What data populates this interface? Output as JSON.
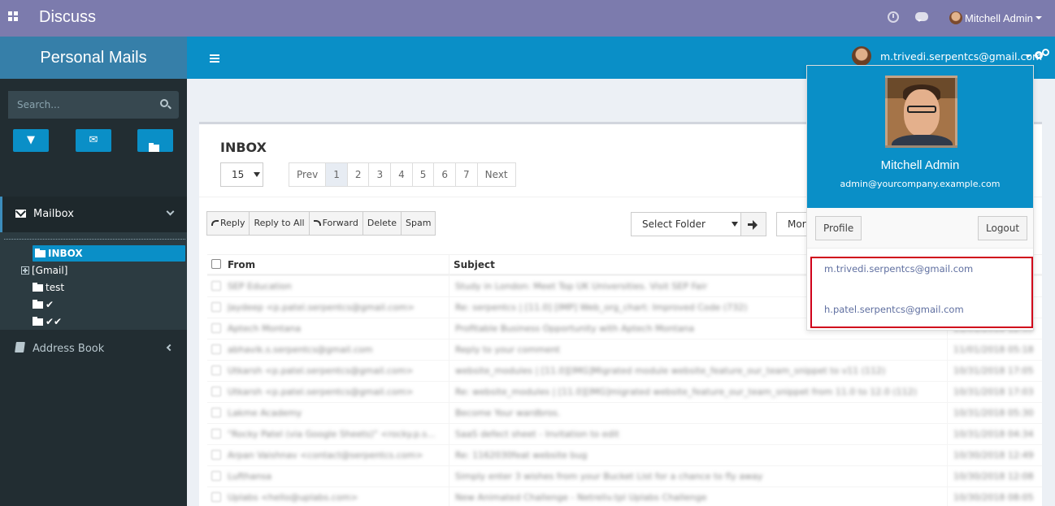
{
  "app": {
    "title": "Discuss",
    "user_name": "Mitchell Admin"
  },
  "sidebar": {
    "brand": "Personal Mails",
    "search_placeholder": "Search...",
    "mailbox_label": "Mailbox",
    "folders": {
      "inbox": "INBOX",
      "gmail": "[Gmail]",
      "test": "test",
      "check1": "✔",
      "check2": "✔✔"
    },
    "address_book_label": "Address Book"
  },
  "header": {
    "account_email": "m.trivedi.serpentcs@gmail.com"
  },
  "inbox": {
    "title": "INBOX",
    "page_size": "15",
    "pagination": {
      "prev": "Prev",
      "pages": [
        "1",
        "2",
        "3",
        "4",
        "5",
        "6",
        "7"
      ],
      "current": "1",
      "next": "Next"
    },
    "actions": {
      "reply": "Reply",
      "reply_all": "Reply to All",
      "forward": "Forward",
      "delete": "Delete",
      "spam": "Spam"
    },
    "folder_select": "Select Folder",
    "more": "More",
    "columns": {
      "from": "From",
      "subject": "Subject"
    },
    "rows": [
      {
        "from": "SEP Education",
        "subject": "Study in London: Meet Top UK Universities. Visit SEP Fair",
        "date": ""
      },
      {
        "from": "Jaydeep <p.patel.serpentcs@gmail.com>",
        "subject": "Re: serpentcs | [11.0] [IMP] Web_org_chart: Improved Code (732)",
        "date": ""
      },
      {
        "from": "Aptech Montana",
        "subject": "Profitable Business Opportunity with Aptech Montana",
        "date": "11/01/2018 12:55"
      },
      {
        "from": "abhavik.s.serpentcs@gmail.com",
        "subject": "Reply to your comment",
        "date": "11/01/2018 05:18"
      },
      {
        "from": "Utkarsh <p.patel.serpentcs@gmail.com>",
        "subject": "website_modules | [11.0][IMG]Migrated module website_feature_our_team_snippet to v11 (112)",
        "date": "10/31/2018 17:05"
      },
      {
        "from": "Utkarsh <p.patel.serpentcs@gmail.com>",
        "subject": "Re: website_modules | [11.0][IMG]migrated website_feature_our_team_snippet from 11.0 to 12.0 (112)",
        "date": "10/31/2018 17:03"
      },
      {
        "from": "Lakme Academy",
        "subject": "Become Your wardbros.",
        "date": "10/31/2018 05:30"
      },
      {
        "from": "\"Rocky Patel (via Google Sheets)\" <rocky.p.s...",
        "subject": "SaaS defect sheet - Invitation to edit",
        "date": "10/31/2018 04:34"
      },
      {
        "from": "Arpan Vaishnav <contact@serpentcs.com>",
        "subject": "Re: 1162030feat website bug",
        "date": "10/30/2018 12:49"
      },
      {
        "from": "Lufthansa",
        "subject": "Simply enter 3 wishes from your Bucket List for a chance to fly away",
        "date": "10/30/2018 12:08"
      },
      {
        "from": "Uplabs <hello@uplabs.com>",
        "subject": "New Animated Challenge - Netreliv.tpl Uplabs Challenge",
        "date": "10/30/2018 08:05"
      }
    ]
  },
  "account_dropdown": {
    "name": "Mitchell Admin",
    "email": "admin@yourcompany.example.com",
    "profile_btn": "Profile",
    "logout_btn": "Logout",
    "accounts": [
      "m.trivedi.serpentcs@gmail.com",
      "h.patel.serpentcs@gmail.com"
    ]
  }
}
